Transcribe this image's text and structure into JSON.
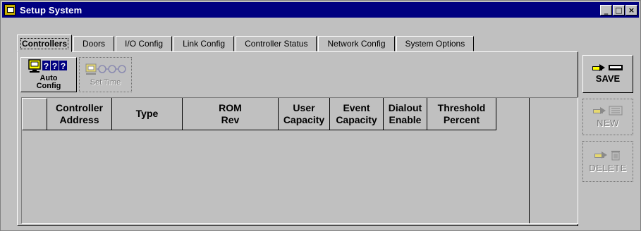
{
  "window": {
    "title": "Setup System",
    "minimize": "_",
    "maximize": "□",
    "close": "×"
  },
  "tabs": [
    {
      "label": "Controllers",
      "active": true
    },
    {
      "label": "Doors"
    },
    {
      "label": "I/O Config"
    },
    {
      "label": "Link Config"
    },
    {
      "label": "Controller Status"
    },
    {
      "label": "Network Config"
    },
    {
      "label": "System Options"
    }
  ],
  "toolbar": {
    "auto_config_label": "Auto\nConfig",
    "auto_config_glyphs": "???",
    "set_time_label": "Set Time"
  },
  "table": {
    "columns": [
      "",
      "Controller\nAddress",
      "Type",
      "ROM\nRev",
      "User\nCapacity",
      "Event\nCapacity",
      "Dialout\nEnable",
      "Threshold\nPercent"
    ],
    "rows": []
  },
  "actions": {
    "save_label": "SAVE",
    "new_label": "NEW",
    "delete_label": "DELETE"
  },
  "colors": {
    "titlebar": "#000080",
    "face": "#c0c0c0",
    "accent_yellow": "#ffff00"
  }
}
